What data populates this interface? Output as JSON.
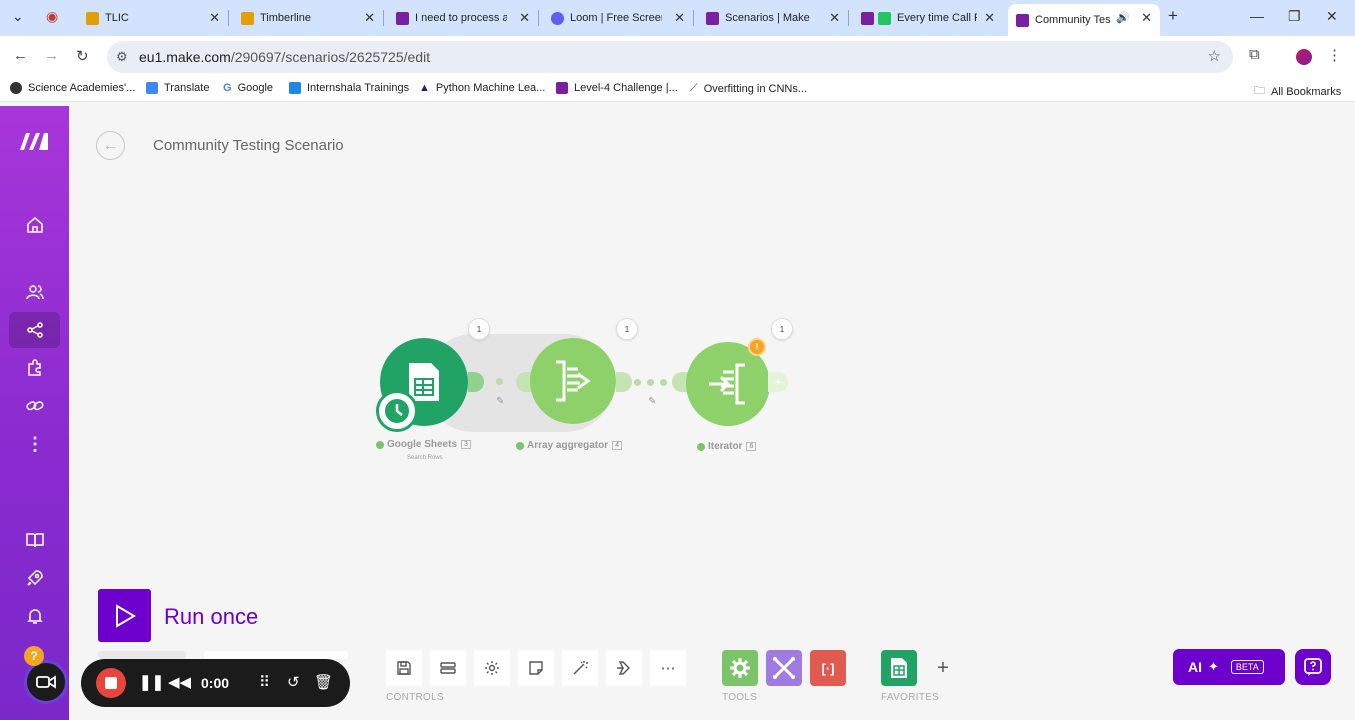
{
  "browser": {
    "tabs": [
      {
        "title": "TLIC",
        "favicon_color": "#e2a000"
      },
      {
        "title": "Timberline",
        "favicon_color": "#e2a000"
      },
      {
        "title": "I need to process a",
        "favicon_color": "#7b1fa2"
      },
      {
        "title": "Loom | Free Screen",
        "favicon_color": "#625df5"
      },
      {
        "title": "Scenarios | Make",
        "favicon_color": "#7b1fa2"
      },
      {
        "title": "Every time Call F",
        "favicon_color": "#22c55e"
      },
      {
        "title": "Community Tes",
        "favicon_color": "#7b1fa2"
      }
    ],
    "url_host": "eu1.make.com",
    "url_path": "/290697/scenarios/2625725/edit",
    "bookmarks": [
      "Science Academies'...",
      "Translate",
      "Google",
      "Internshala Trainings",
      "Python Machine Lea...",
      "Level-4 Challenge |...",
      "Overfitting in CNNs..."
    ],
    "all_bookmarks": "All Bookmarks"
  },
  "scenario": {
    "title": "Community Testing Scenario",
    "modules": [
      {
        "name": "Google Sheets",
        "id": "3",
        "subtitle": "Search Rows",
        "ops": "1"
      },
      {
        "name": "Array aggregator",
        "id": "4",
        "ops": "1"
      },
      {
        "name": "Iterator",
        "id": "6",
        "ops": "1"
      }
    ]
  },
  "run": {
    "label": "Run once"
  },
  "toolbar": {
    "controls_label": "CONTROLS",
    "tools_label": "TOOLS",
    "favorites_label": "FAVORITES",
    "controls_icons": [
      "save-icon",
      "scenario-io-icon",
      "settings-icon",
      "notes-icon",
      "auto-align-icon",
      "explain-flow-icon",
      "more-icon"
    ]
  },
  "ai": {
    "label": "AI",
    "badge": "BETA"
  },
  "recorder": {
    "time": "0:00",
    "help": "?"
  },
  "colors": {
    "brand": "#6d00cc",
    "sheets_green": "#21a366",
    "tool_green": "#7cc46a",
    "tool_purple": "#a07ce0",
    "tool_red": "#e05a4f"
  }
}
